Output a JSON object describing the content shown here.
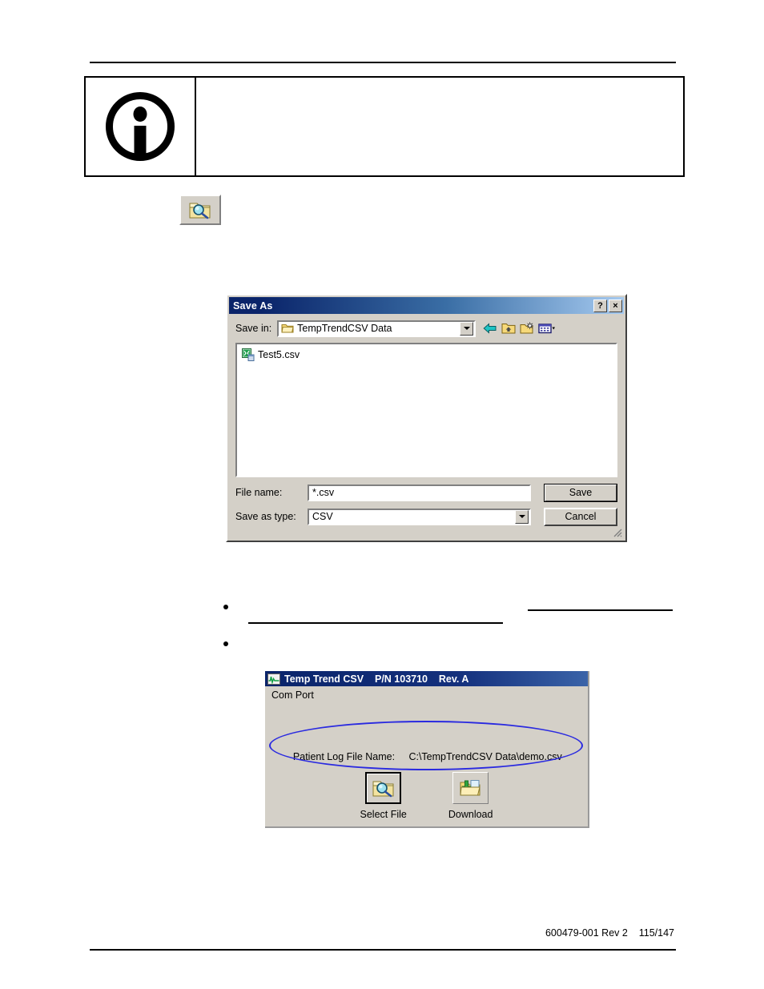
{
  "page": {
    "footer": "600479-001 Rev 2    115/147"
  },
  "note_box": {
    "icon": "info-icon",
    "body_text": ""
  },
  "inline_icon": {
    "name": "select-file-icon"
  },
  "save_as_dialog": {
    "title": "Save As",
    "help_button": "?",
    "close_button": "×",
    "save_in_label": "Save in:",
    "save_in_value": "TempTrendCSV Data",
    "nav_icons": [
      "back-arrow-icon",
      "up-one-level-icon",
      "new-folder-icon",
      "views-icon"
    ],
    "files": [
      {
        "name": "Test5.csv",
        "icon": "csv-file-icon"
      }
    ],
    "file_name_label": "File name:",
    "file_name_value": "*.csv",
    "save_as_type_label": "Save as type:",
    "save_as_type_value": "CSV",
    "save_button": "Save",
    "cancel_button": "Cancel"
  },
  "app_window": {
    "title": "Temp Trend CSV    P/N 103710    Rev. A",
    "menu": "Com Port",
    "patient_log_label": "Patient Log File Name:",
    "patient_log_value": "C:\\TempTrendCSV Data\\demo.csv",
    "buttons": [
      {
        "label": "Select File",
        "icon": "folder-magnifier-icon"
      },
      {
        "label": "Download",
        "icon": "folder-download-icon"
      }
    ],
    "annotation_color": "#2a2ae0"
  },
  "colors": {
    "dialog_face": "#d4d0c8",
    "titlebar_start": "#0a246a",
    "titlebar_end": "#a6caf0",
    "annotation": "#2a2ae0"
  }
}
